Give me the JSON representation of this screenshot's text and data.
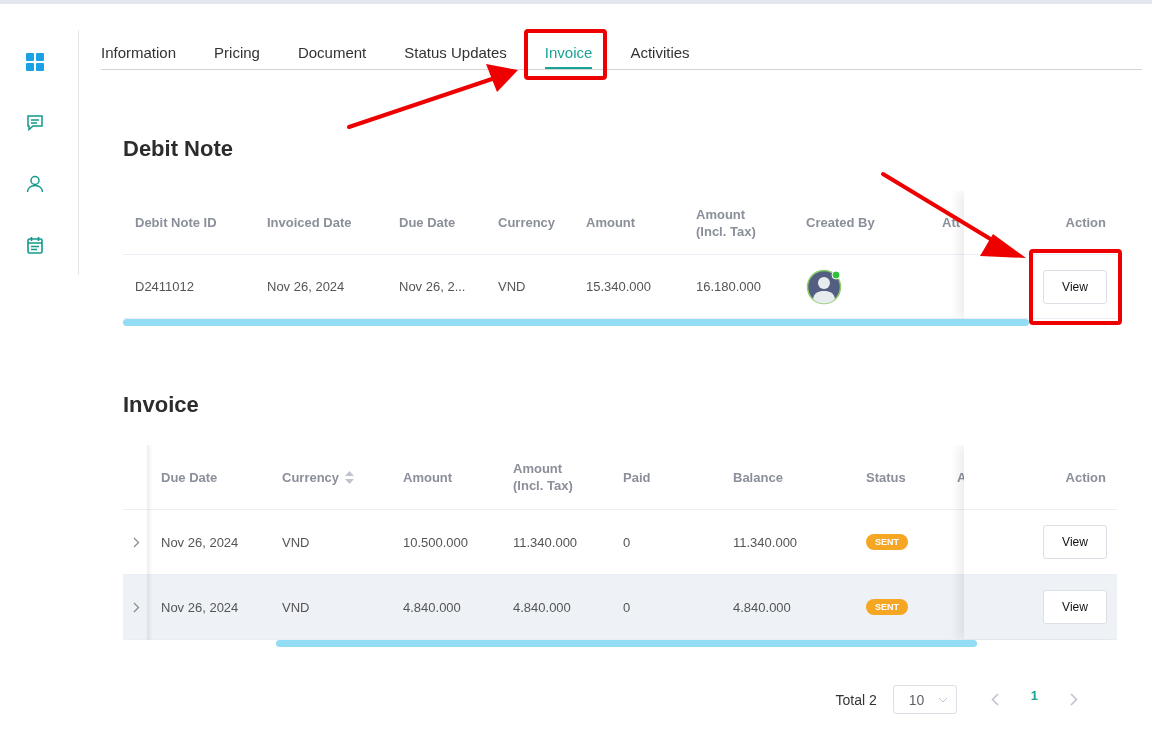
{
  "sidebar_items": [
    {
      "selected": true
    },
    {
      "selected": false
    },
    {
      "selected": false
    },
    {
      "selected": false
    }
  ],
  "tabs": [
    {
      "label": "Information",
      "selected": false
    },
    {
      "label": "Pricing",
      "selected": false
    },
    {
      "label": "Document",
      "selected": false
    },
    {
      "label": "Status Updates",
      "selected": false
    },
    {
      "label": "Invoice",
      "selected": true
    },
    {
      "label": "Activities",
      "selected": false
    }
  ],
  "debit_note": {
    "title": "Debit Note",
    "columns": [
      "Debit Note ID",
      "Invoiced Date",
      "Due Date",
      "Currency",
      "Amount",
      "Amount (Incl. Tax)",
      "Created By",
      "Att"
    ],
    "action_column": "Action",
    "rows": [
      {
        "cells": [
          "D2411012",
          "Nov 26, 2024",
          "Nov 26, 2...",
          "VND",
          "15.340.000",
          "16.180.000"
        ],
        "creator_online": true,
        "action": "View"
      }
    ]
  },
  "invoice": {
    "title": "Invoice",
    "columns": [
      {
        "label": "Due Date",
        "sortable": false
      },
      {
        "label": "Currency",
        "sortable": true
      },
      {
        "label": "Amount",
        "sortable": false
      },
      {
        "label": "Amount (Incl. Tax)",
        "sortable": false
      },
      {
        "label": "Paid",
        "sortable": false
      },
      {
        "label": "Balance",
        "sortable": false
      },
      {
        "label": "Status",
        "sortable": false
      },
      {
        "label": "A",
        "sortable": false
      }
    ],
    "action_column": "Action",
    "rows": [
      {
        "cells": [
          "Nov 26, 2024",
          "VND",
          "10.500.000",
          "11.340.000",
          "0",
          "11.340.000"
        ],
        "status": "SENT",
        "expanded": false,
        "highlighted": false,
        "action": "View"
      },
      {
        "cells": [
          "Nov 26, 2024",
          "VND",
          "4.840.000",
          "4.840.000",
          "0",
          "4.840.000"
        ],
        "status": "SENT",
        "expanded": false,
        "highlighted": true,
        "action": "View"
      }
    ]
  },
  "pagination": {
    "total": "Total 2",
    "page_size": "10",
    "prev_disabled": true,
    "next_disabled": true,
    "pages": [
      {
        "label": "1",
        "selected": true
      }
    ]
  }
}
